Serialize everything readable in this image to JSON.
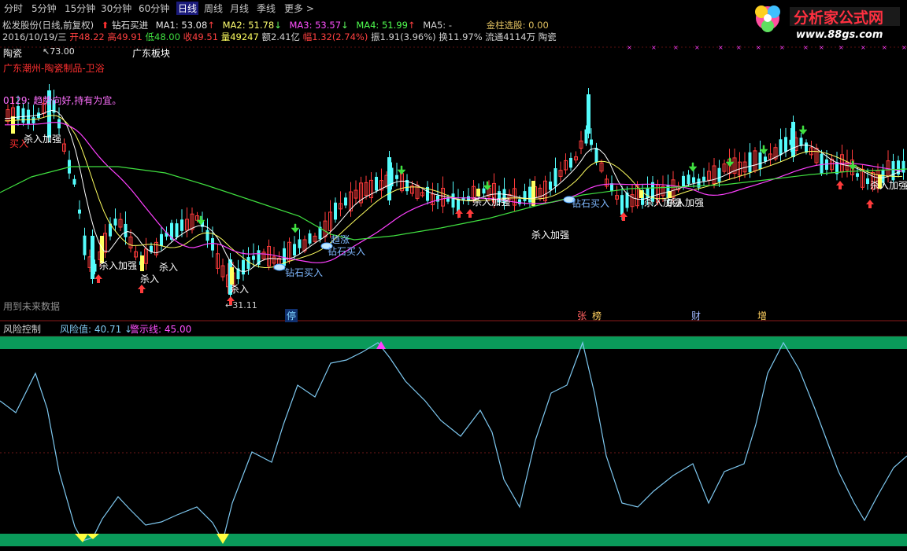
{
  "tabs": [
    "分时",
    "5分钟",
    "15分钟",
    "30分钟",
    "60分钟",
    "日线",
    "周线",
    "月线",
    "季线",
    "更多 >"
  ],
  "active_tab": "日线",
  "indicator_row": {
    "stock": "松发股份(日线,前复权)",
    "signal_icon": "red-up-arrow-icon",
    "signal": "钻石买进",
    "ma1": "MA1: 53.08",
    "ma2": "MA2: 51.78",
    "ma3": "MA3: 53.57",
    "ma4": "MA4: 51.99",
    "ma5": "MA5: -",
    "golden": "金柱选股: 0.00"
  },
  "quote_row": {
    "date": "2016/10/19/三",
    "open": "开48.22",
    "high": "高49.91",
    "low": "低48.00",
    "close": "收49.51",
    "volume": "量49247",
    "amount": "额2.41亿",
    "change": "幅1.32(2.74%)",
    "amplitude": "振1.91(3.96%)",
    "turnover": "换11.97%",
    "float": "流通4114万",
    "sector": "陶瓷"
  },
  "main_panel": {
    "sector_tag": "陶瓷",
    "high_marker": "73.00",
    "board_label": "广东板块",
    "region": "广东潮州-陶瓷制品-卫浴",
    "comment": "0129: 趋势向好,持有为宜。",
    "low_marker": "31.11",
    "footnote": "用到未来数据",
    "buy_label": "买入",
    "add_label": "杀入加强",
    "kill_label": "杀入",
    "diamond_label": "钻石买入",
    "rise_label": "趋涨",
    "event_tags": [
      {
        "text": "停",
        "color": "#7fd4ff",
        "bg": "#10306e"
      },
      {
        "text": "张",
        "color": "#ff6060",
        "bg": ""
      },
      {
        "text": "榜",
        "color": "#ffd060",
        "bg": ""
      },
      {
        "text": "财",
        "color": "#a0b8ff",
        "bg": ""
      },
      {
        "text": "增",
        "color": "#ffd060",
        "bg": ""
      }
    ]
  },
  "risk_panel": {
    "title": "风险控制",
    "value_label": "风险值: 40.71",
    "warn_label": "警示线: 45.00"
  },
  "logo": {
    "title": "分析家公式网",
    "url": "www.88gs.com"
  },
  "colors": {
    "up": "#ff3b3b",
    "down": "#54fcfc",
    "ma_white": "#ffffff",
    "ma_yellow": "#ffff60",
    "ma_magenta": "#ff40ff",
    "ma_green": "#40e040",
    "risk_line": "#7ec8f0",
    "band": "#0a9a5a"
  }
}
